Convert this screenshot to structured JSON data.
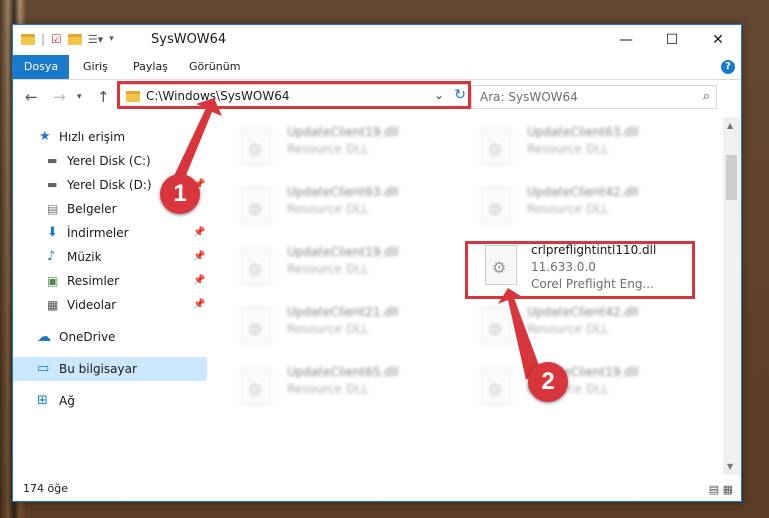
{
  "window": {
    "title": "SysWOW64",
    "controls": {
      "minimize": "—",
      "maximize": "☐",
      "close": "✕"
    }
  },
  "ribbon": {
    "tabs": [
      "Dosya",
      "Giriş",
      "Paylaş",
      "Görünüm"
    ],
    "help": "?"
  },
  "navigation": {
    "address": "C:\\Windows\\SysWOW64",
    "search_placeholder": "Ara: SysWOW64"
  },
  "sidebar": {
    "items": [
      {
        "label": "Hızlı erişim",
        "icon": "star-icon"
      },
      {
        "label": "Yerel Disk (C:)",
        "icon": "drive-icon"
      },
      {
        "label": "Yerel Disk (D:)",
        "icon": "drive-icon"
      },
      {
        "label": "Belgeler",
        "icon": "documents-icon"
      },
      {
        "label": "İndirmeler",
        "icon": "download-icon"
      },
      {
        "label": "Müzik",
        "icon": "music-icon"
      },
      {
        "label": "Resimler",
        "icon": "pictures-icon"
      },
      {
        "label": "Videolar",
        "icon": "videos-icon"
      },
      {
        "label": "OneDrive",
        "icon": "cloud-icon"
      },
      {
        "label": "Bu bilgisayar",
        "icon": "computer-icon"
      },
      {
        "label": "Ağ",
        "icon": "network-icon"
      }
    ]
  },
  "files": [
    {
      "name": "UpdateClient19.dll",
      "sub": "Resource DLL"
    },
    {
      "name": "UpdateClient63.dll",
      "sub": "Resource DLL"
    },
    {
      "name": "UpdateClient63.dll",
      "sub": "Resource DLL"
    },
    {
      "name": "UpdateClient42.dll",
      "sub": "Resource DLL"
    },
    {
      "name": "UpdateClient19.dll",
      "sub": "Resource DLL"
    },
    {
      "name": "crlpreflightintl110.dll",
      "sub": "11.633.0.0",
      "sub2": "Corel Preflight Eng..."
    },
    {
      "name": "UpdateClient21.dll",
      "sub": "Resource DLL"
    },
    {
      "name": "UpdateClient42.dll",
      "sub": "Resource DLL"
    },
    {
      "name": "UpdateClient65.dll",
      "sub": "Resource DLL"
    },
    {
      "name": "UpdateClient19.dll",
      "sub": "Resource DLL"
    }
  ],
  "status": {
    "count": "174 öğe"
  },
  "callouts": [
    "1",
    "2"
  ],
  "colors": {
    "accent": "#1979ca",
    "highlight": "#d8353c",
    "selected": "#cce8ff"
  }
}
